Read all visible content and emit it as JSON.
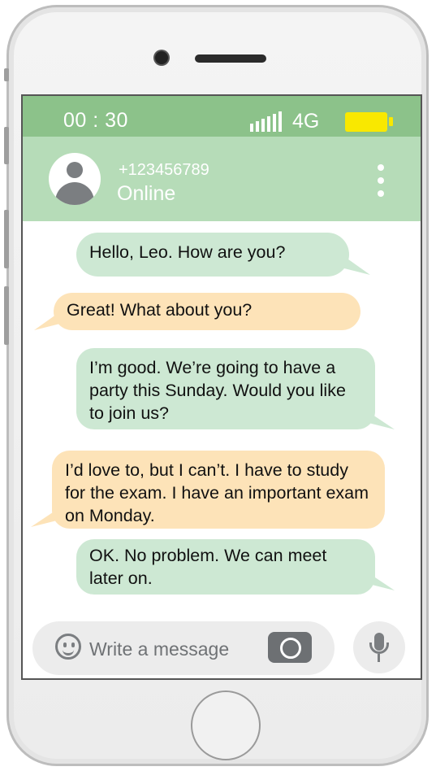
{
  "status_bar": {
    "time": "00 : 30",
    "network": "4G",
    "signal_icon": "signal-bars-icon",
    "battery_icon": "battery-icon",
    "colors": {
      "bar": "#8cc28a",
      "battery": "#f9e800"
    }
  },
  "contact": {
    "avatar_icon": "user-avatar-icon",
    "phone_number": "+123456789",
    "status": "Online",
    "menu_icon": "more-vertical-icon",
    "header_color": "#b6dcb8"
  },
  "messages": [
    {
      "direction": "sent",
      "text": "Hello, Leo. How are you?"
    },
    {
      "direction": "received",
      "text": "Great! What about you?"
    },
    {
      "direction": "sent",
      "text": "I’m good. We’re going to have a party this Sunday. Would you like to join us?"
    },
    {
      "direction": "received",
      "text": "I’d love to, but I can’t. I have to study for the exam. I have an important exam on Monday."
    },
    {
      "direction": "sent",
      "text": "OK. No problem. We can meet later on."
    }
  ],
  "bubble_colors": {
    "sent": "#cde8d3",
    "received": "#fde3b8"
  },
  "composer": {
    "emoji_icon": "emoji-smile-icon",
    "placeholder": "Write a message",
    "camera_icon": "camera-icon",
    "mic_icon": "microphone-icon"
  }
}
